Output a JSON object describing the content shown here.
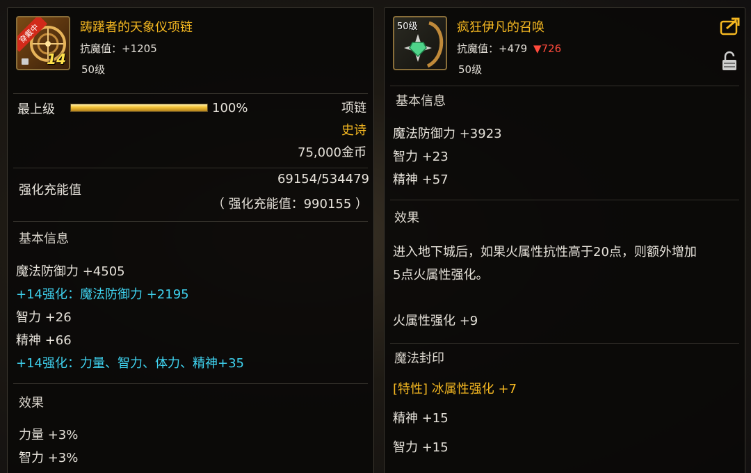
{
  "left_item": {
    "badge_equipped": "穿戴中",
    "enhance_badge": "14",
    "name": "踌躇者的天象仪项链",
    "magic_resist": "抗魔值：+1205",
    "level": "50级",
    "grade_label": "最上级",
    "grade_percent": "100%",
    "grade_progress": 1.0,
    "type": "项链",
    "rarity": "史诗",
    "price": "75,000金币",
    "charge_label": "强化充能值",
    "charge_value": "69154/534479",
    "charge_total": "（ 强化充能值：990155 ）",
    "basic_header": "基本信息",
    "stats": [
      {
        "text": "魔法防御力 +4505",
        "style": "normal"
      },
      {
        "text": "+14强化：魔法防御力 +2195",
        "style": "cyan"
      },
      {
        "text": "智力 +26",
        "style": "normal"
      },
      {
        "text": "精神 +66",
        "style": "normal"
      },
      {
        "text": "+14强化：力量、智力、体力、精神+35",
        "style": "cyan"
      }
    ],
    "effect_header": "效果",
    "effects": [
      "力量 +3%",
      "智力 +3%"
    ]
  },
  "right_item": {
    "level_badge": "50级",
    "name": "疯狂伊凡的召唤",
    "magic_resist": "抗魔值：+479",
    "resist_diff": "▼726",
    "level": "50级",
    "basic_header": "基本信息",
    "stats": [
      "魔法防御力 +3923",
      "智力 +23",
      "精神 +57"
    ],
    "effect_header": "效果",
    "effect_desc_1": "进入地下城后，如果火属性抗性高于20点，则额外增加",
    "effect_desc_2": "5点火属性强化。",
    "effect_bonus": "火属性强化 +9",
    "seal_header": "魔法封印",
    "seal_lines": [
      {
        "text": "[特性] 冰属性强化 +7",
        "style": "gold"
      },
      {
        "text": "精神 +15",
        "style": "normal"
      },
      {
        "text": "智力 +15",
        "style": "normal"
      }
    ]
  },
  "icons": {
    "left_item_icon": "astrolabe-necklace-icon",
    "lock_small": "padlock-icon",
    "right_item_icon": "green-gem-pendant-icon",
    "share": "share-arrow-icon",
    "lock_open": "unlocked-padlock-icon"
  },
  "colors": {
    "title": "#f5b821",
    "enhance": "#3fd3f0",
    "down": "#ff4a3c"
  }
}
